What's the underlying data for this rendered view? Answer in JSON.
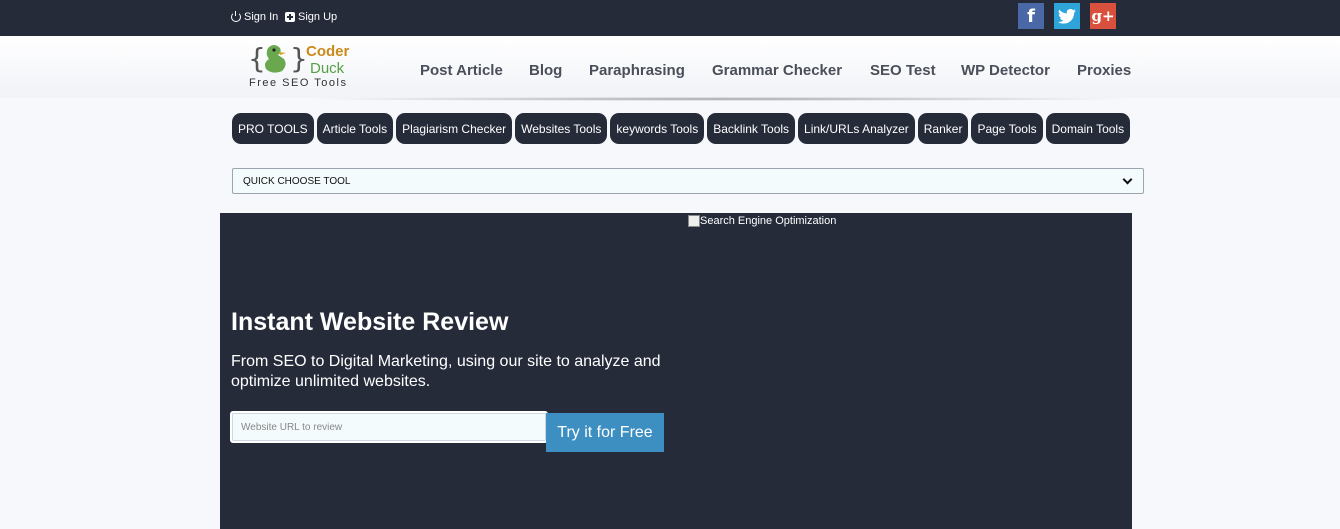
{
  "topbar": {
    "sign_in": "Sign In",
    "sign_up": "Sign Up",
    "social": {
      "facebook": "f",
      "twitter": "twitter-bird-icon",
      "googleplus": "g+"
    }
  },
  "logo": {
    "word1": "Coder",
    "word2": "Duck",
    "tagline": "Free SEO Tools"
  },
  "nav": [
    "Post Article",
    "Blog",
    "Paraphrasing",
    "Grammar Checker",
    "SEO Test",
    "WP Detector",
    "Proxies"
  ],
  "categories": [
    "PRO TOOLS",
    "Article Tools",
    "Plagiarism Checker",
    "Websites Tools",
    "keywords Tools",
    "Backlink Tools",
    "Link/URLs Analyzer",
    "Ranker",
    "Page Tools",
    "Domain Tools"
  ],
  "quick_choose": {
    "selected": "QUICK CHOOSE TOOL"
  },
  "hero": {
    "image_alt": "Search Engine Optimization",
    "title": "Instant Website Review",
    "subtitle": "From SEO to Digital Marketing, using our site to analyze and optimize unlimited websites.",
    "input_placeholder": "Website URL to review",
    "button": "Try it for Free"
  },
  "colors": {
    "dark": "#262b3a",
    "button_blue": "#3d8fc2",
    "facebook": "#4a67a6",
    "twitter": "#2fa4d9",
    "googleplus": "#d9503d"
  }
}
